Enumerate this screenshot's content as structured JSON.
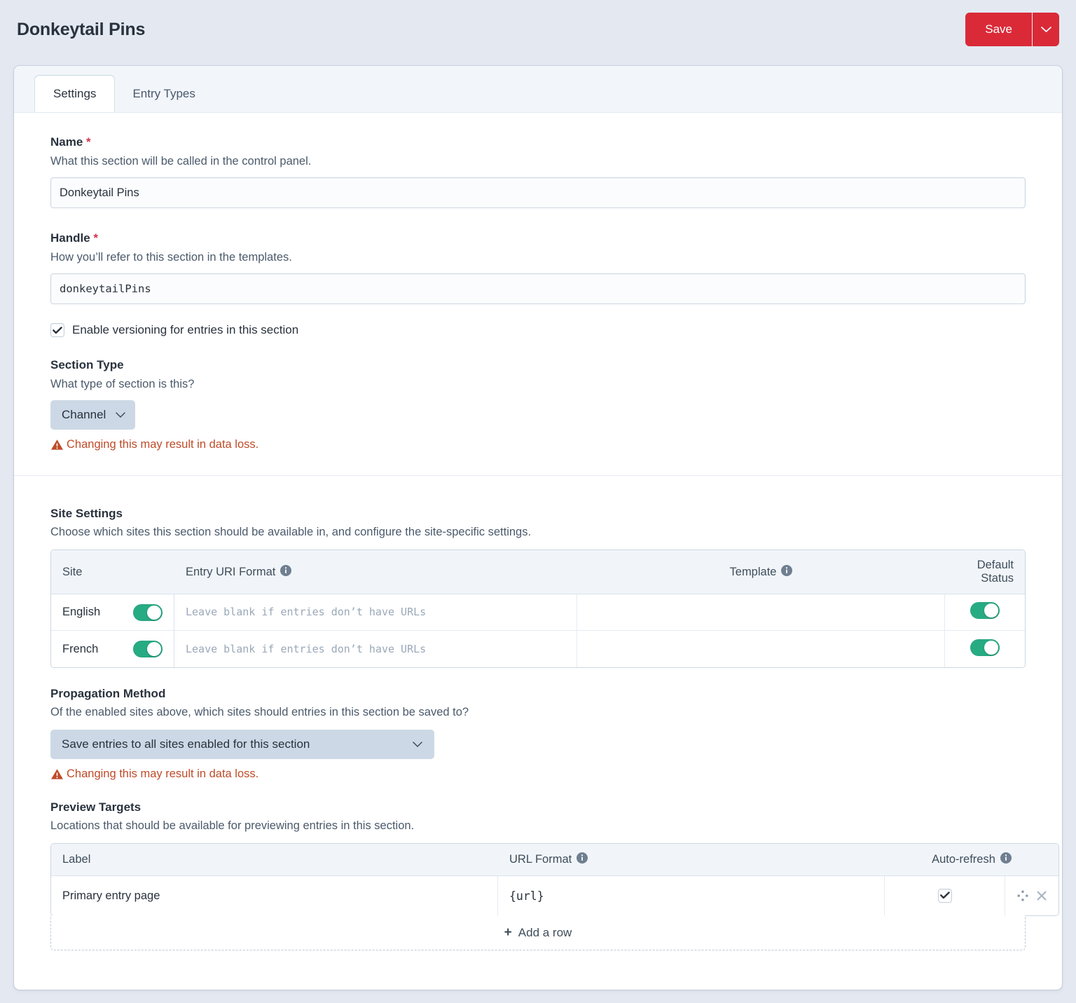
{
  "header": {
    "title": "Donkeytail Pins",
    "save_label": "Save",
    "save_caret_icon": "chevron-down-icon",
    "accent_color": "#da2a38"
  },
  "tabs": [
    {
      "label": "Settings",
      "active": true
    },
    {
      "label": "Entry Types",
      "active": false
    }
  ],
  "settings": {
    "name": {
      "label": "Name",
      "required_marker": "*",
      "instructions": "What this section will be called in the control panel.",
      "value": "Donkeytail Pins"
    },
    "handle": {
      "label": "Handle",
      "required_marker": "*",
      "instructions": "How you’ll refer to this section in the templates.",
      "value": "donkeytailPins"
    },
    "versioning": {
      "label": "Enable versioning for entries in this section",
      "checked": true
    },
    "section_type": {
      "label": "Section Type",
      "instructions": "What type of section is this?",
      "value": "Channel",
      "warning": "Changing this may result in data loss.",
      "warning_color": "#bf4b28"
    }
  },
  "site_settings": {
    "heading": "Site Settings",
    "description": "Choose which sites this section should be available in, and configure the site-specific settings.",
    "columns": {
      "site": "Site",
      "entry_uri_format": "Entry URI Format",
      "template": "Template",
      "default_status": "Default Status"
    },
    "uri_placeholder": "Leave blank if entries don’t have URLs",
    "rows": [
      {
        "site": "English",
        "enabled": true,
        "entry_uri_format": "",
        "template": "",
        "default_status": true
      },
      {
        "site": "French",
        "enabled": true,
        "entry_uri_format": "",
        "template": "",
        "default_status": true
      }
    ],
    "toggle_on_color": "#27ab83"
  },
  "propagation": {
    "heading": "Propagation Method",
    "description": "Of the enabled sites above, which sites should entries in this section be saved to?",
    "value": "Save entries to all sites enabled for this section",
    "warning": "Changing this may result in data loss."
  },
  "preview_targets": {
    "heading": "Preview Targets",
    "description": "Locations that should be available for previewing entries in this section.",
    "columns": {
      "label": "Label",
      "url_format": "URL Format",
      "auto_refresh": "Auto-refresh"
    },
    "rows": [
      {
        "label": "Primary entry page",
        "url_format": "{url}",
        "auto_refresh": true
      }
    ],
    "add_row_label": "Add a row",
    "move_icon": "move-handle-icon",
    "delete_icon": "close-icon"
  }
}
